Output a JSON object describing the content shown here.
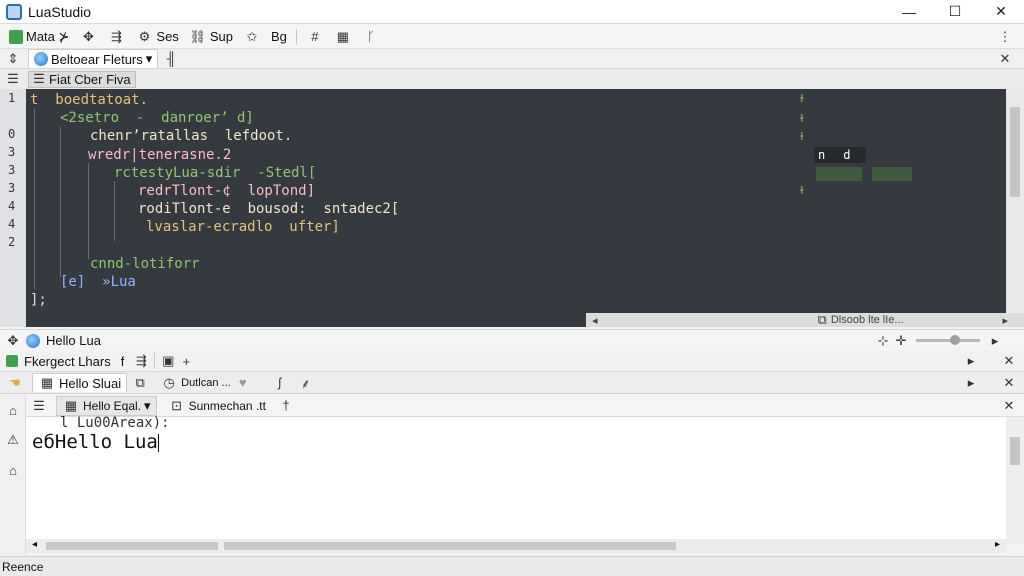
{
  "window": {
    "title": "LuaStudio",
    "minimize": "—",
    "maximize": "☐",
    "close": "✕"
  },
  "toolbar": {
    "items": [
      {
        "label": "Mata ⊁"
      },
      {
        "label": ""
      },
      {
        "label": "Ses"
      },
      {
        "label": "Sup"
      },
      {
        "label": "Bg"
      }
    ]
  },
  "tabs": {
    "active": "Beltoear Fleturs",
    "dropdown_glyph": "▾",
    "split_glyph": "╢"
  },
  "file_tab": {
    "label": "Fiat Cber Fiva"
  },
  "editor": {
    "gutter": [
      "1",
      "",
      "0",
      "3",
      "3",
      "3",
      "4",
      "4",
      "2",
      "",
      ""
    ],
    "lines": [
      {
        "text": "t  boedtatoat.",
        "color": "#e6c270",
        "indent": 0
      },
      {
        "text": "<2setro  -  danroerʼ d]",
        "color": "#8fc76d",
        "indent": 30
      },
      {
        "text": "chenrʼratallas  lefdoot.",
        "color": "#f0e6c8",
        "indent": 60
      },
      {
        "text": "wredr|tenerasne.2",
        "color": "#ffb8c8",
        "indent": 58
      },
      {
        "text": "rctestyLua-sdir  -Stedl[",
        "color": "#8fc76d",
        "indent": 84
      },
      {
        "text": "redrTlont-¢  lopTond]",
        "color": "#ffb8c8",
        "indent": 108
      },
      {
        "text": "rodiTlont-e  bousod:  sntadec2[",
        "color": "#f0e6c8",
        "indent": 108
      },
      {
        "text": "lvaslar-ecradlo  ufter]",
        "color": "#e6c270",
        "indent": 116
      },
      {
        "text": "",
        "color": "#e0e0e0",
        "indent": 0
      },
      {
        "text": "cnnd-lotiforr",
        "color": "#8fc76d",
        "indent": 60
      },
      {
        "text": "[e]  »Lua",
        "color": "#8fb4ff",
        "indent": 30
      },
      {
        "text": "];",
        "color": "#e0e0e0",
        "indent": 0
      }
    ],
    "minimap": {
      "box_left": "n",
      "box_right": "d"
    },
    "status_strip": "Dlsoob lte  lIe..."
  },
  "output_panel": {
    "title": "Hello Lua"
  },
  "panel_row": {
    "label": "Fkergect Lhars",
    "caret": "f"
  },
  "output_tabs": {
    "tab1": "Hello Sluai",
    "tab2": "Dutlcan ..."
  },
  "output_sub": {
    "dropdown": "Hello Eqal.",
    "option": "Sunmechan .tt"
  },
  "console": {
    "line1": "l Lu00Areax):",
    "line2": "eбHello Lua"
  },
  "status": {
    "text": "Reence"
  }
}
